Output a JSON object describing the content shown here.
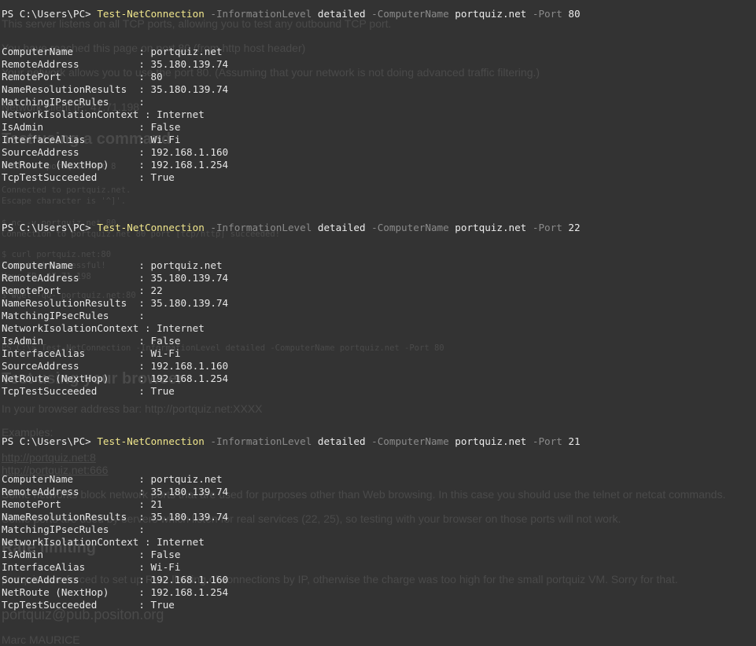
{
  "background_page": {
    "lines": [
      "This server listens on all TCP ports, allowing you to test any outbound TCP port.",
      "You have reached this page on port 80 (from http host header)",
      "Your network allows you to use the port 80. (Assuming that your network is not doing advanced traffic filtering.)",
      "Network client IP: 47.71.198",
      "Test using a command",
      "$ telnet portquiz.net 8",
      "Connected to portquiz.net.",
      "Escape character is '^]'.",
      "$ nc -v portquiz.net 80",
      "Connection to portquiz.net 80 port [tcp/http] succeeded!",
      "$ curl portquiz.net:80",
      "Port test successful!",
      "Your IP: 47.71.198",
      "$ wget -qO- portquiz.net:80",
      "PS C:\\> Test-NetConnection -InformationLevel detailed -ComputerName portquiz.net -Port 80",
      "Test using your browser",
      "In your browser address bar: http://portquiz.net:XXXX",
      "Examples:",
      "http://portquiz.net:8",
      "http://portquiz.net:666",
      "Some networks block network ports that are used for purposes other than Web browsing. In this case you should use the telnet or netcat commands.",
      "Some ports are used by servers which listen for real services (22, 25), so testing with your browser on those ports will not work.",
      "Rate limiting",
      "portquiz was forced to set up Rate limiting of connections by IP, otherwise the charge was too high for the small portquiz VM. Sorry for that.",
      "portquiz@pub.positon.org",
      "Marc MAURICE"
    ]
  },
  "terminal": {
    "runs": [
      {
        "prompt": "PS C:\\Users\\PC> ",
        "cmdlet": "Test-NetConnection",
        "p1": " -InformationLevel ",
        "v1": "detailed",
        "p2": " -ComputerName ",
        "v2": "portquiz.net",
        "p3": " -Port ",
        "v3": "80",
        "output": [
          "ComputerName           : portquiz.net",
          "RemoteAddress          : 35.180.139.74",
          "RemotePort             : 80",
          "NameResolutionResults  : 35.180.139.74",
          "MatchingIPsecRules     :",
          "NetworkIsolationContext : Internet",
          "IsAdmin                : False",
          "InterfaceAlias         : Wi-Fi",
          "SourceAddress          : 192.168.1.160",
          "NetRoute (NextHop)     : 192.168.1.254",
          "TcpTestSucceeded       : True"
        ]
      },
      {
        "prompt": "PS C:\\Users\\PC> ",
        "cmdlet": "Test-NetConnection",
        "p1": " -InformationLevel ",
        "v1": "detailed",
        "p2": " -ComputerName ",
        "v2": "portquiz.net",
        "p3": " -Port ",
        "v3": "22",
        "output": [
          "ComputerName           : portquiz.net",
          "RemoteAddress          : 35.180.139.74",
          "RemotePort             : 22",
          "NameResolutionResults  : 35.180.139.74",
          "MatchingIPsecRules     :",
          "NetworkIsolationContext : Internet",
          "IsAdmin                : False",
          "InterfaceAlias         : Wi-Fi",
          "SourceAddress          : 192.168.1.160",
          "NetRoute (NextHop)     : 192.168.1.254",
          "TcpTestSucceeded       : True"
        ]
      },
      {
        "prompt": "PS C:\\Users\\PC> ",
        "cmdlet": "Test-NetConnection",
        "p1": " -InformationLevel ",
        "v1": "detailed",
        "p2": " -ComputerName ",
        "v2": "portquiz.net",
        "p3": " -Port ",
        "v3": "21",
        "output": [
          "ComputerName           : portquiz.net",
          "RemoteAddress          : 35.180.139.74",
          "RemotePort             : 21",
          "NameResolutionResults  : 35.180.139.74",
          "MatchingIPsecRules     :",
          "NetworkIsolationContext : Internet",
          "IsAdmin                : False",
          "InterfaceAlias         : Wi-Fi",
          "SourceAddress          : 192.168.1.160",
          "NetRoute (NextHop)     : 192.168.1.254",
          "TcpTestSucceeded       : True"
        ]
      }
    ]
  },
  "colors": {
    "background": "#333333",
    "cmdlet": "#f0e68c",
    "parameter": "#8a8a8a",
    "text": "#e6e6e6",
    "ghost_text": "#4a4a4a"
  }
}
